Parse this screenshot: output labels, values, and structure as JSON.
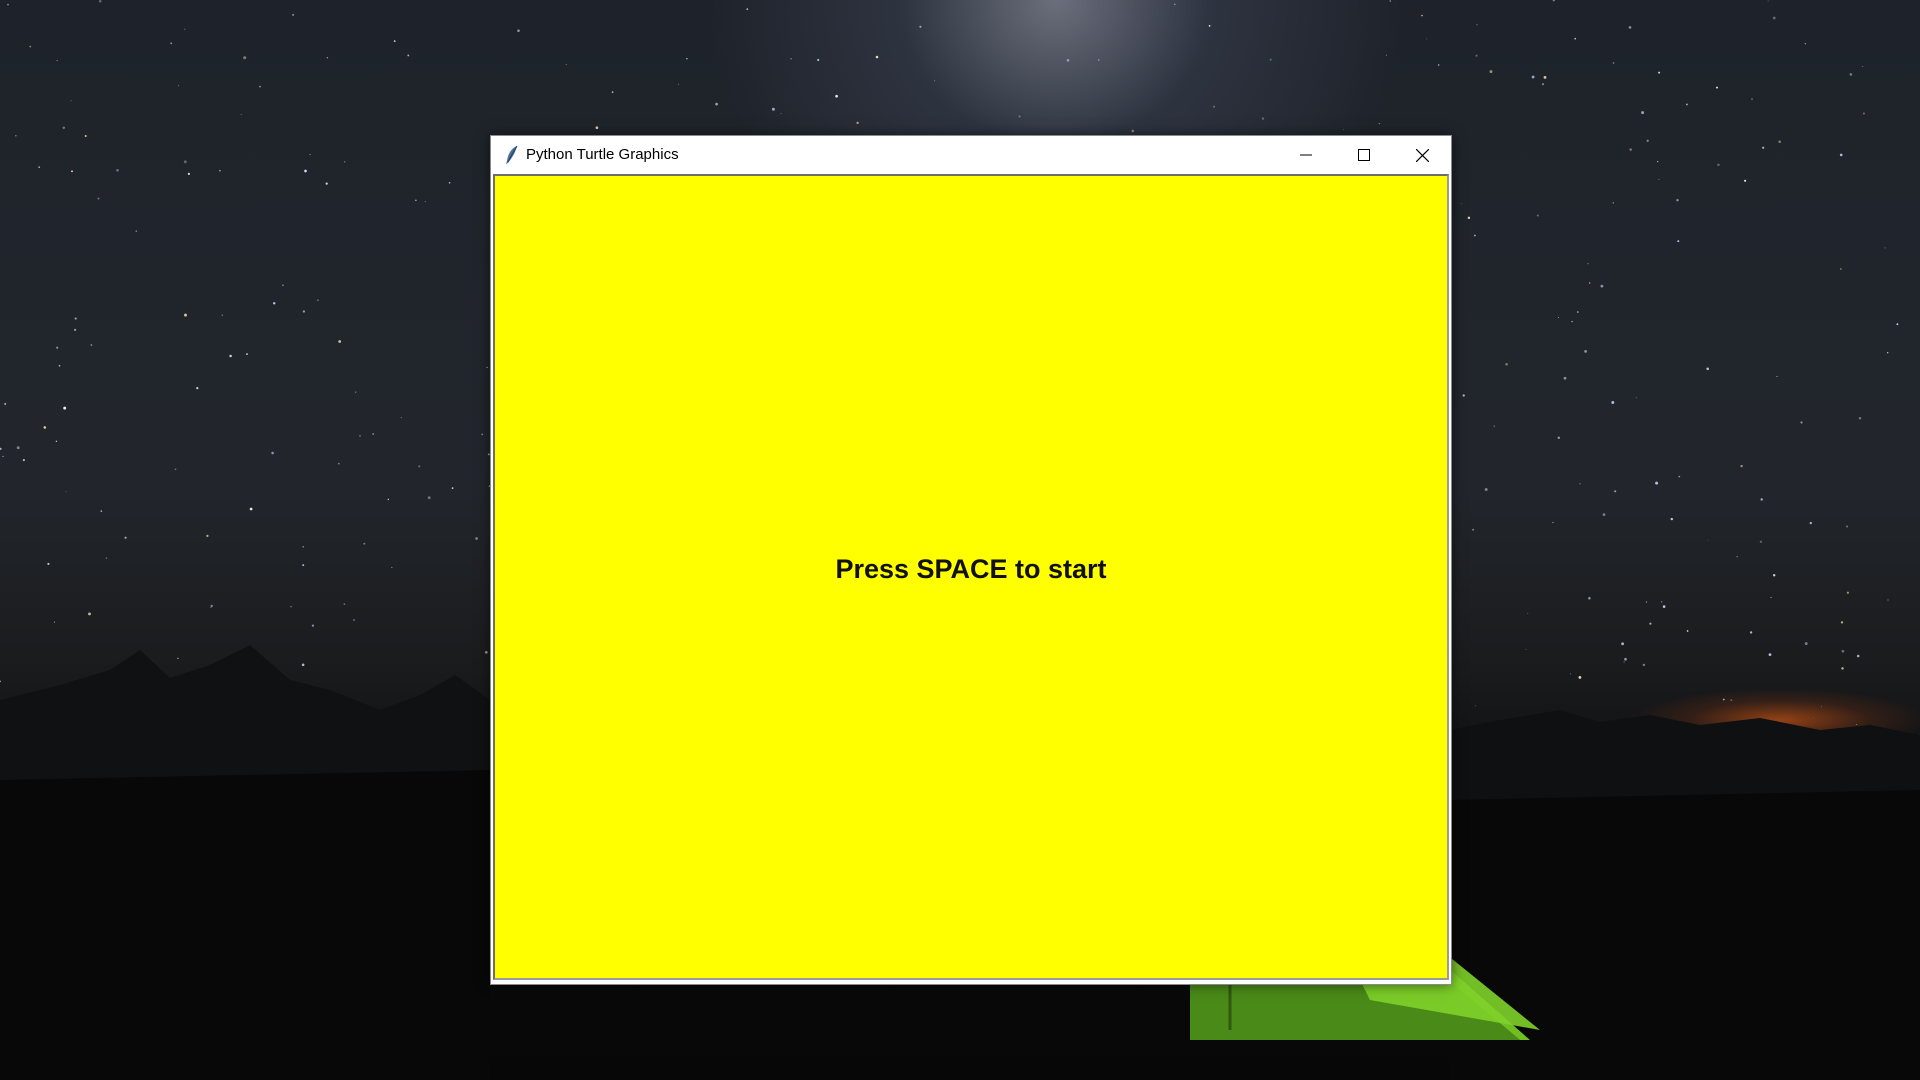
{
  "window": {
    "title": "Python Turtle Graphics",
    "app_icon": "feather-icon",
    "controls": {
      "minimize_icon": "minimize-icon",
      "maximize_icon": "maximize-icon",
      "close_icon": "close-icon"
    }
  },
  "canvas": {
    "background_color": "#ffff00",
    "message": "Press SPACE to start"
  }
}
